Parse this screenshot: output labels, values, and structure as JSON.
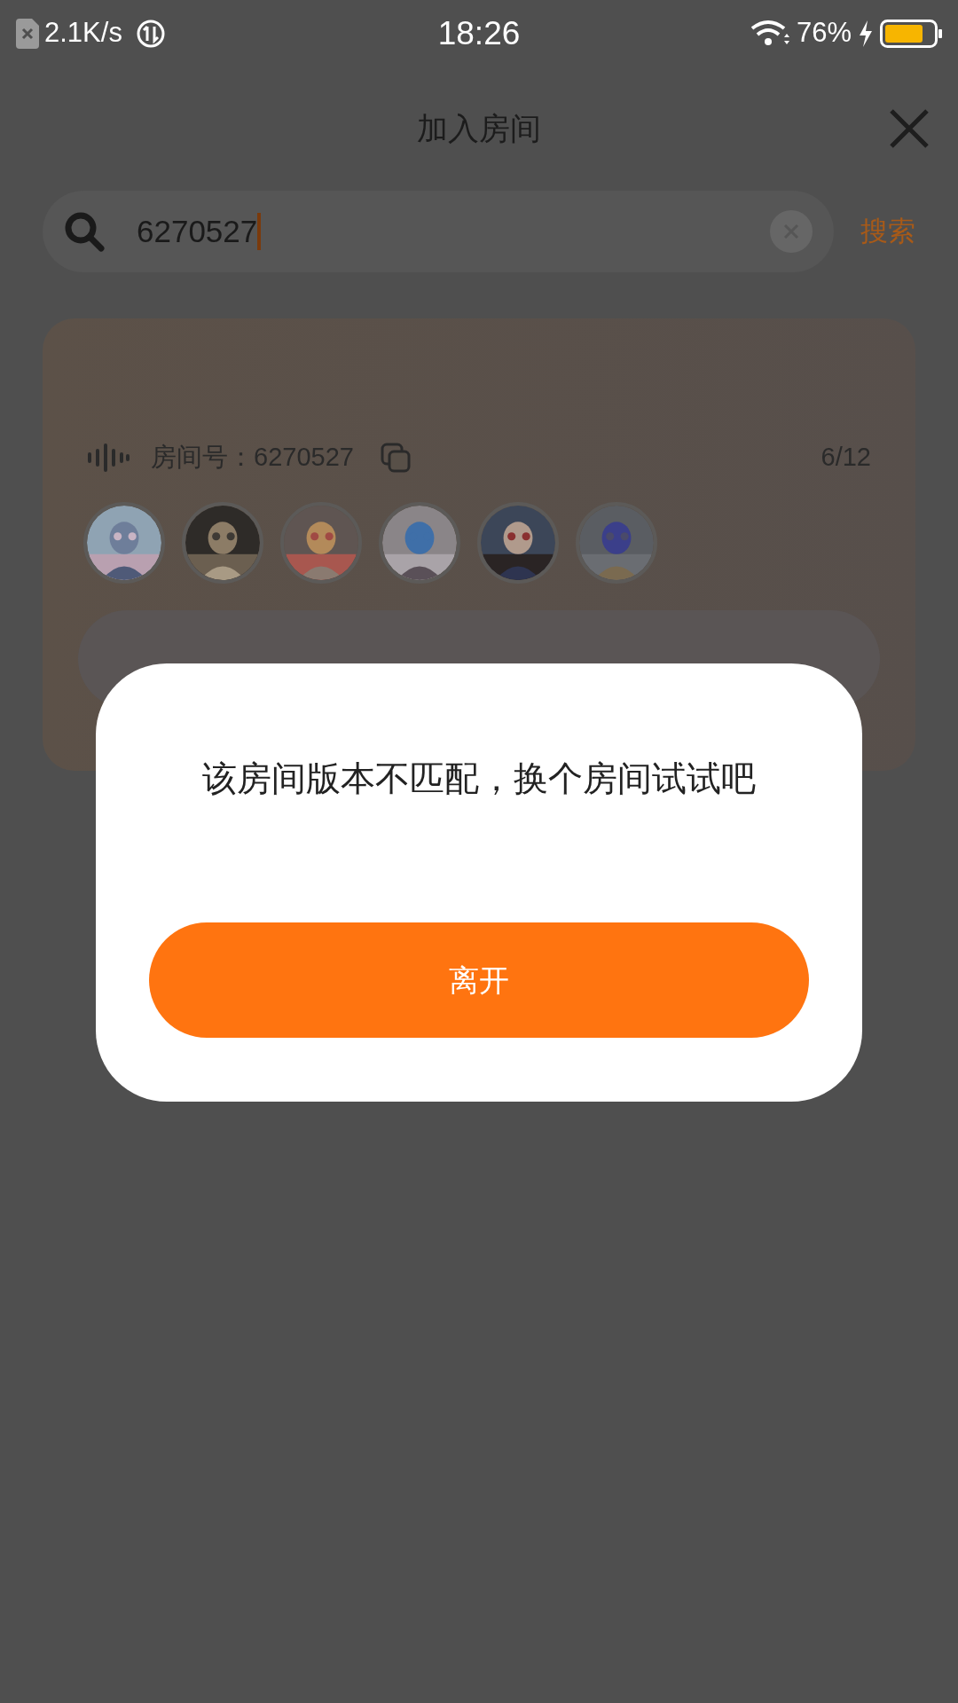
{
  "status_bar": {
    "speed": "2.1K/s",
    "time": "18:26",
    "battery": "76%"
  },
  "header": {
    "title": "加入房间"
  },
  "search": {
    "value": "6270527",
    "button": "搜索"
  },
  "room": {
    "label": "房间号：6270527",
    "count": "6/12"
  },
  "dialog": {
    "message": "该房间版本不匹配，换个房间试试吧",
    "button": "离开"
  }
}
